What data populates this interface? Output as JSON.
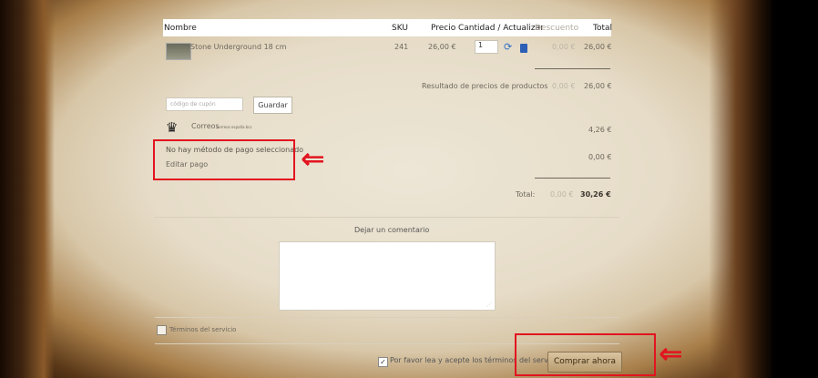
{
  "table": {
    "headers": {
      "name": "Nombre",
      "sku": "SKU",
      "price": "Precio",
      "qty": "Cantidad / Actualizar",
      "discount": "Descuento",
      "total": "Total"
    },
    "item": {
      "name": "Stone Underground 18 cm",
      "sku": "241",
      "price": "26,00 €",
      "qty": "1",
      "discount": "0,00 €",
      "total": "26,00 €"
    }
  },
  "summary": {
    "products_label": "Resultado de precios de productos",
    "products_discount": "0,00 €",
    "products_total": "26,00 €",
    "shipping_value": "4,26 €",
    "payment_value": "0,00 €",
    "total_label": "Total:",
    "total_discount": "0,00 €",
    "total_value": "30,26 €"
  },
  "coupon": {
    "placeholder": "código de cupón",
    "button": "Guardar"
  },
  "shipping": {
    "name": "Correos",
    "desc": "correos españa bcc"
  },
  "payment": {
    "none": "No hay método de pago seleccionado",
    "edit": "Editar pago"
  },
  "comment": {
    "label": "Dejar un comentario"
  },
  "terms": {
    "link": "Términos del servicio",
    "agree": "Por favor lea y acepte los términos del servicio.",
    "checked": "✓"
  },
  "buy": {
    "button": "Comprar ahora"
  },
  "icons": {
    "arrow": "⇐",
    "refresh": "⟳",
    "correos": "♛",
    "grip": "⋰"
  },
  "colors": {
    "highlight": "#e2141f",
    "button": "#c7ad81"
  }
}
